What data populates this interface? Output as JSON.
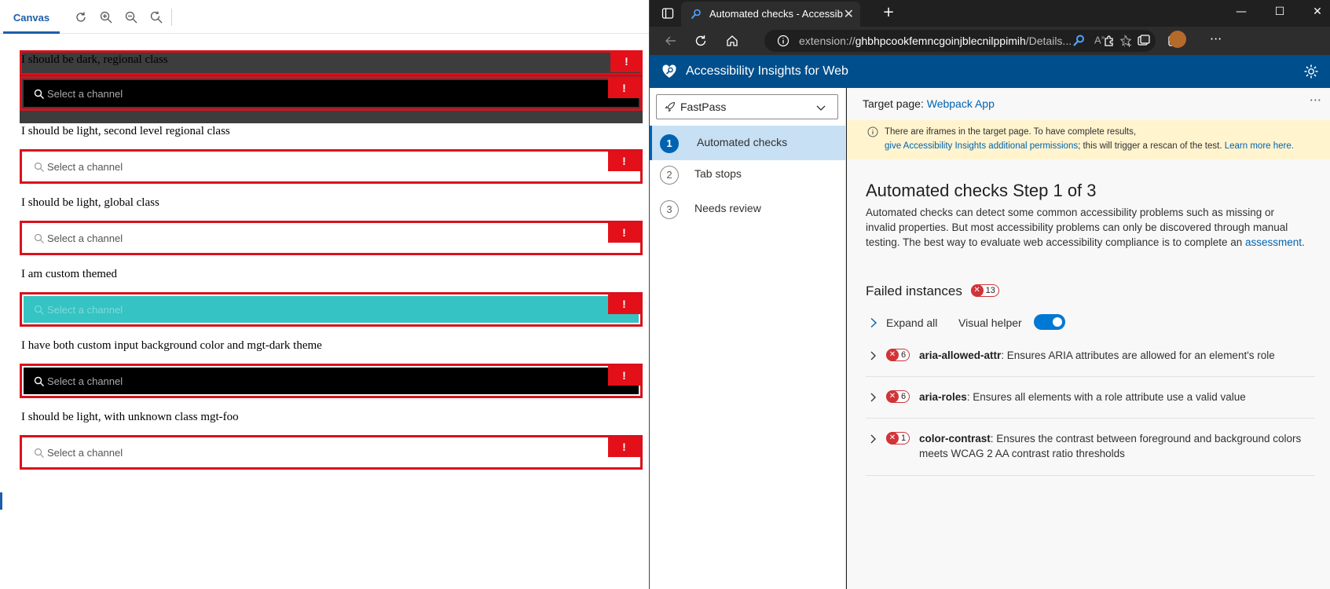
{
  "canvas": {
    "tab_label": "Canvas",
    "toolbar_icons": [
      "refresh-icon",
      "zoom-in-icon",
      "zoom-out-icon",
      "reset-zoom-icon"
    ],
    "error_glyph": "!",
    "placeholder": "Select a channel",
    "sections": [
      {
        "label": "I should be dark, regional class",
        "theme": "dark"
      },
      {
        "label": "I should be light, second level regional class",
        "theme": "light"
      },
      {
        "label": "I should be light, global class",
        "theme": "light"
      },
      {
        "label": "I am custom themed",
        "theme": "custom"
      },
      {
        "label": "I have both custom input background color and mgt-dark theme",
        "theme": "dark"
      },
      {
        "label": "I should be light, with unknown class mgt-foo",
        "theme": "light"
      }
    ],
    "colors": {
      "error_red": "#e31019",
      "dark_band": "#3d3d3d",
      "custom_teal": "#35c3c3"
    }
  },
  "browser": {
    "tab_title": "Automated checks - Accessibility Insights",
    "tab_close": "✕",
    "new_tab": "+",
    "window_controls": {
      "minimize": "—",
      "maximize": "☐",
      "close": "✕"
    },
    "url_prefix": "extension://",
    "url_host": "ghbhpcookfemncgoinjblecnilppimih",
    "url_path": "/Details...",
    "colors": {
      "chrome_dark": "#202020",
      "header_blue": "#004e8c",
      "accent": "#0078d4"
    }
  },
  "app": {
    "name": "Accessibility Insights for Web",
    "mode": "FastPass",
    "nav": [
      {
        "num": "1",
        "label": "Automated checks",
        "selected": true
      },
      {
        "num": "2",
        "label": "Tab stops",
        "selected": false
      },
      {
        "num": "3",
        "label": "Needs review",
        "selected": false
      }
    ],
    "target_label": "Target page: ",
    "target_link": "Webpack App",
    "more": "···",
    "banner": {
      "line1": "There are iframes in the target page. To have complete results,",
      "link1": "give Accessibility Insights additional permissions",
      "line2_rest": "; this will trigger a rescan of the test. ",
      "link2": "Learn more here."
    },
    "heading": "Automated checks Step 1 of 3",
    "description": "Automated checks can detect some common accessibility problems such as missing or invalid properties. But most accessibility problems can only be discovered through manual testing. The best way to evaluate web accessibility compliance is to complete an ",
    "description_link": "assessment",
    "description_end": ".",
    "failed_label": "Failed instances",
    "failed_count": "13",
    "expand_all": "Expand all",
    "visual_helper": "Visual helper",
    "visual_helper_on": true,
    "badge_x": "✕",
    "rules": [
      {
        "count": "6",
        "name": "aria-allowed-attr",
        "desc": ": Ensures ARIA attributes are allowed for an element's role"
      },
      {
        "count": "6",
        "name": "aria-roles",
        "desc": ": Ensures all elements with a role attribute use a valid value"
      },
      {
        "count": "1",
        "name": "color-contrast",
        "desc": ": Ensures the contrast between foreground and background colors meets WCAG 2 AA contrast ratio thresholds"
      }
    ]
  }
}
